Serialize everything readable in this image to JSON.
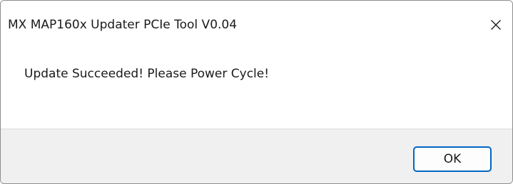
{
  "window": {
    "title": "MX MAP160x Updater PCIe Tool V0.04",
    "close_icon": "close-icon"
  },
  "content": {
    "message": "Update Succeeded! Please Power Cycle!"
  },
  "footer": {
    "ok_label": "OK"
  }
}
